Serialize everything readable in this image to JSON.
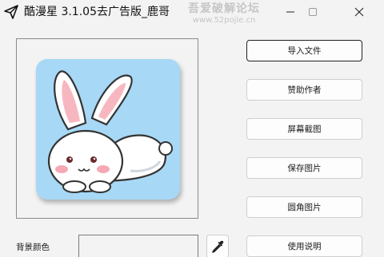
{
  "window": {
    "title": "酷漫星 3.1.05去广告版_鹿哥",
    "watermark_line1": "吾爱破解论坛",
    "watermark_line2": "www.52pojie.cn"
  },
  "icons": {
    "app": "paper-plane-icon",
    "minimize": "minimize-icon",
    "maximize": "maximize-icon",
    "close": "close-icon",
    "picker": "eyedropper-icon"
  },
  "preview": {
    "image_subject": "cartoon white bunny lying down",
    "tile_color": "#a7d8f5"
  },
  "buttons": {
    "import_file": "导入文件",
    "sponsor_author": "赞助作者",
    "screenshot": "屏幕截图",
    "save_image": "保存图片",
    "rounded_image": "圆角图片",
    "instructions": "使用说明"
  },
  "background_color": {
    "label": "背景颜色",
    "value": ""
  }
}
